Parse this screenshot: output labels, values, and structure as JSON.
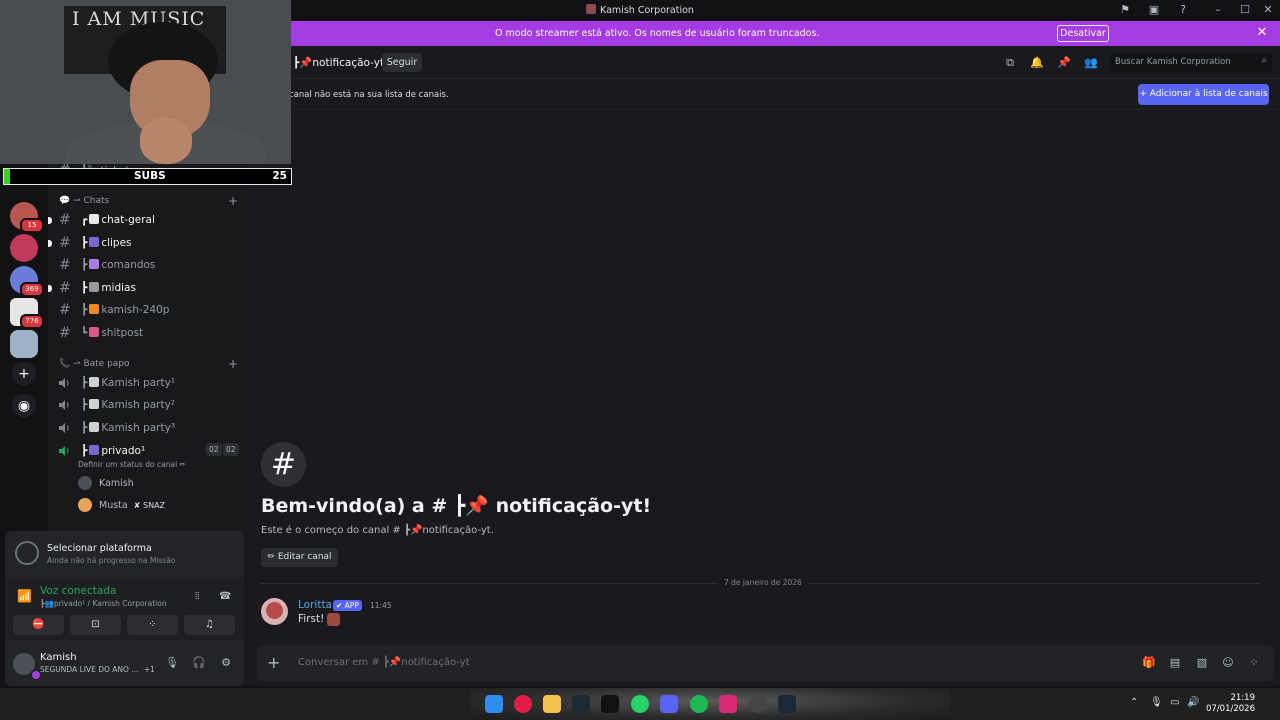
{
  "window": {
    "title": "Kamish Corporation"
  },
  "banner": {
    "text": "O modo streamer está ativo. Os nomes de usuário foram truncados.",
    "button_label": "Desativar"
  },
  "overlay": {
    "poster_text": "I AM MUSIC",
    "subs_label": "SUBS",
    "subs_count": "25"
  },
  "servers": [
    {
      "badge": "15",
      "color": "#b8574f"
    },
    {
      "badge": "",
      "color": "#c23a5a"
    },
    {
      "badge": "369",
      "color": "#6b7bd8"
    },
    {
      "badge": "776",
      "color": "#e6e6e6"
    },
    {
      "badge": "",
      "color": "#9fb3c8"
    }
  ],
  "sidebar": {
    "partial_channel": "┗📞ticket",
    "categories": [
      {
        "label": "💬 ⇀ Chats"
      },
      {
        "label": "📞 ⇀ Bate papo"
      }
    ],
    "text_channels": [
      {
        "label": "chat-geral",
        "prefix": "┏"
      },
      {
        "label": "clipes",
        "prefix": "┣"
      },
      {
        "label": "comandos",
        "prefix": "┣"
      },
      {
        "label": "midias",
        "prefix": "┣"
      },
      {
        "label": "kamish-240p",
        "prefix": "┣"
      },
      {
        "label": "shitpost",
        "prefix": "┗"
      }
    ],
    "voice_channels": [
      {
        "label": "Kamish party¹",
        "prefix": "┣"
      },
      {
        "label": "Kamish party²",
        "prefix": "┣"
      },
      {
        "label": "Kamish party³",
        "prefix": "┣"
      },
      {
        "label": "privado¹",
        "prefix": "┣",
        "count_a": "02",
        "count_b": "02"
      }
    ],
    "channel_status": "Definir um status do canal ✏",
    "voice_users": [
      {
        "name": "Kamish"
      },
      {
        "name": "Musta",
        "tag": "SNAZ"
      }
    ]
  },
  "quest": {
    "title": "Selecionar plataforma",
    "subtitle": "Ainda não há progresso na Missão"
  },
  "voice": {
    "title": "Voz conectada",
    "subtitle": "┣👥privado¹ / Kamish Corporation"
  },
  "user": {
    "name": "Kamish",
    "status": "SEGUNDA LIVE DO ANO ...",
    "extra": "+1"
  },
  "channel": {
    "name": "┣📌notificação-yt",
    "follow_label": "Seguir",
    "search_placeholder": "Buscar Kamish Corporation",
    "notice_text": "canal não está na sua lista de canais.",
    "notice_button": "+ Adicionar à lista de canais"
  },
  "welcome": {
    "title": "Bem-vindo(a) a # ┣📌 notificação-yt!",
    "subtitle": "Este é o começo do canal # ┣📌notificação-yt.",
    "edit_label": "✏ Editar canal"
  },
  "messages": {
    "date_divider": "7 de janeiro de 2026",
    "author": "Loritta",
    "tag": "✔ APP",
    "time": "11:45",
    "text": "First!"
  },
  "composer": {
    "placeholder": "Conversar em # ┣📌notificação-yt"
  },
  "taskbar": {
    "time": "21:19",
    "date": "07/01/2026"
  }
}
